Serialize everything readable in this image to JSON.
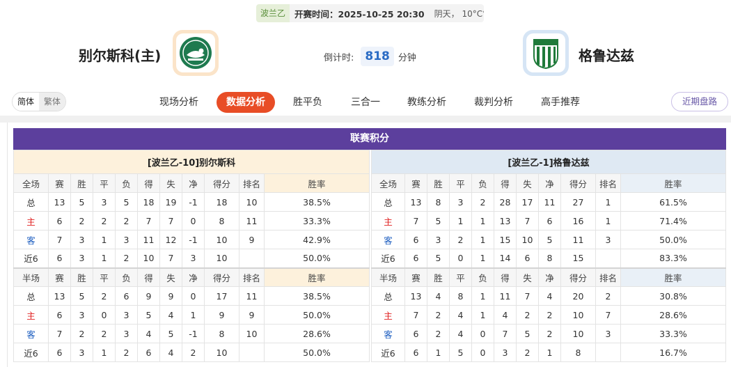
{
  "match": {
    "league": "波兰乙",
    "kickoff_label": "开赛时间：",
    "kickoff_time": "2025-10-25 20:30",
    "weather": "阴天， 10°C℃",
    "countdown_label": "倒计时:",
    "countdown_value": "818",
    "countdown_unit": "分钟",
    "home_team": "别尔斯科(主)",
    "away_team": "格鲁达兹"
  },
  "lang": {
    "simplified": "简体",
    "traditional": "繁体"
  },
  "tabs": [
    "现场分析",
    "数据分析",
    "胜平负",
    "三合一",
    "教练分析",
    "裁判分析",
    "高手推荐"
  ],
  "active_tab": "数据分析",
  "recent_button": "近期盘路",
  "panel_title": "联赛积分",
  "colors": {
    "accent": "#e84d26",
    "panel": "#5c3f9d",
    "home_tint": "#fdf1dc",
    "away_tint": "#dfe9f3"
  },
  "home_table": {
    "title": "[波兰乙-10]别尔斯科",
    "full_header": [
      "全场",
      "赛",
      "胜",
      "平",
      "负",
      "得",
      "失",
      "净",
      "得分",
      "排名",
      "胜率"
    ],
    "full_rows": [
      [
        "总",
        "13",
        "5",
        "3",
        "5",
        "18",
        "19",
        "-1",
        "18",
        "10",
        "38.5%"
      ],
      [
        "主",
        "6",
        "2",
        "2",
        "2",
        "7",
        "7",
        "0",
        "8",
        "11",
        "33.3%"
      ],
      [
        "客",
        "7",
        "3",
        "1",
        "3",
        "11",
        "12",
        "-1",
        "10",
        "9",
        "42.9%"
      ],
      [
        "近6",
        "6",
        "3",
        "1",
        "2",
        "10",
        "7",
        "3",
        "10",
        "",
        "50.0%"
      ]
    ],
    "half_header": [
      "半场",
      "赛",
      "胜",
      "平",
      "负",
      "得",
      "失",
      "净",
      "得分",
      "排名",
      "胜率"
    ],
    "half_rows": [
      [
        "总",
        "13",
        "5",
        "2",
        "6",
        "9",
        "9",
        "0",
        "17",
        "11",
        "38.5%"
      ],
      [
        "主",
        "6",
        "3",
        "0",
        "3",
        "5",
        "4",
        "1",
        "9",
        "9",
        "50.0%"
      ],
      [
        "客",
        "7",
        "2",
        "2",
        "3",
        "4",
        "5",
        "-1",
        "8",
        "10",
        "28.6%"
      ],
      [
        "近6",
        "6",
        "3",
        "1",
        "2",
        "6",
        "4",
        "2",
        "10",
        "",
        "50.0%"
      ]
    ]
  },
  "away_table": {
    "title": "[波兰乙-1]格鲁达兹",
    "full_header": [
      "全场",
      "赛",
      "胜",
      "平",
      "负",
      "得",
      "失",
      "净",
      "得分",
      "排名",
      "胜率"
    ],
    "full_rows": [
      [
        "总",
        "13",
        "8",
        "3",
        "2",
        "28",
        "17",
        "11",
        "27",
        "1",
        "61.5%"
      ],
      [
        "主",
        "7",
        "5",
        "1",
        "1",
        "13",
        "7",
        "6",
        "16",
        "1",
        "71.4%"
      ],
      [
        "客",
        "6",
        "3",
        "2",
        "1",
        "15",
        "10",
        "5",
        "11",
        "3",
        "50.0%"
      ],
      [
        "近6",
        "6",
        "5",
        "0",
        "1",
        "14",
        "6",
        "8",
        "15",
        "",
        "83.3%"
      ]
    ],
    "half_header": [
      "半场",
      "赛",
      "胜",
      "平",
      "负",
      "得",
      "失",
      "净",
      "得分",
      "排名",
      "胜率"
    ],
    "half_rows": [
      [
        "总",
        "13",
        "4",
        "8",
        "1",
        "11",
        "7",
        "4",
        "20",
        "2",
        "30.8%"
      ],
      [
        "主",
        "7",
        "2",
        "4",
        "1",
        "4",
        "2",
        "2",
        "10",
        "7",
        "28.6%"
      ],
      [
        "客",
        "6",
        "2",
        "4",
        "0",
        "7",
        "5",
        "2",
        "10",
        "3",
        "33.3%"
      ],
      [
        "近6",
        "6",
        "1",
        "5",
        "0",
        "3",
        "2",
        "1",
        "8",
        "",
        "16.7%"
      ]
    ]
  }
}
